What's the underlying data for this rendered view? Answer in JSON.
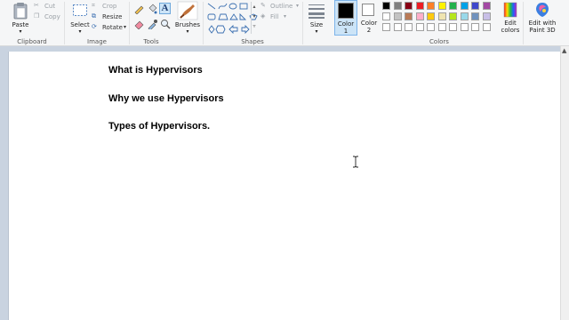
{
  "ribbon": {
    "clipboard": {
      "label": "Clipboard",
      "paste_label": "Paste",
      "cut_label": "Cut",
      "copy_label": "Copy"
    },
    "image": {
      "label": "Image",
      "select_label": "Select",
      "crop_label": "Crop",
      "resize_label": "Resize",
      "rotate_label": "Rotate"
    },
    "tools": {
      "label": "Tools",
      "text_tool_glyph": "A"
    },
    "brushes": {
      "label": "Brushes"
    },
    "shapes": {
      "label": "Shapes",
      "outline_label": "Outline",
      "fill_label": "Fill"
    },
    "size": {
      "label": "Size"
    },
    "color1": {
      "label_line1": "Color",
      "label_line2": "1",
      "value": "#000000"
    },
    "color2": {
      "label_line1": "Color",
      "label_line2": "2",
      "value": "#ffffff"
    },
    "colors": {
      "label": "Colors",
      "palette_row1": [
        "#000000",
        "#7f7f7f",
        "#880015",
        "#ed1c24",
        "#ff7f27",
        "#fff200",
        "#22b14c",
        "#00a2e8",
        "#3f48cc",
        "#a349a4"
      ],
      "palette_row2": [
        "#ffffff",
        "#c3c3c3",
        "#b97a57",
        "#ffaec9",
        "#ffc90e",
        "#efe4b0",
        "#b5e61d",
        "#99d9ea",
        "#7092be",
        "#c8bfe7"
      ],
      "palette_row3": [
        "#ffffff",
        "#ffffff",
        "#ffffff",
        "#ffffff",
        "#ffffff",
        "#ffffff",
        "#ffffff",
        "#ffffff",
        "#ffffff",
        "#ffffff"
      ]
    },
    "edit_colors": {
      "label_line1": "Edit",
      "label_line2": "colors"
    },
    "paint3d": {
      "label_line1": "Edit with",
      "label_line2": "Paint 3D"
    }
  },
  "canvas": {
    "lines": [
      "What is Hypervisors",
      "Why we use Hypervisors",
      "Types of Hypervisors."
    ],
    "cursor_icon": "text-ibeam-cursor"
  }
}
